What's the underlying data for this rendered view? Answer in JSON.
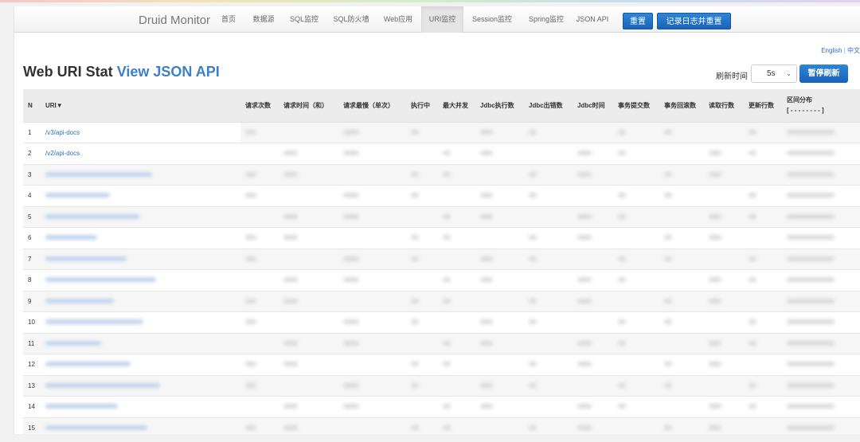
{
  "nav": {
    "brand": "Druid Monitor",
    "items": [
      "首页",
      "数据源",
      "SQL监控",
      "SQL防火墙",
      "Web应用",
      "URI监控",
      "Session监控",
      "Spring监控",
      "JSON API"
    ],
    "active_index": 5,
    "reset_label": "重置",
    "reset_log_label": "记录日志并重置"
  },
  "lang": {
    "english": "English",
    "separator": "|",
    "chinese": "中文"
  },
  "page": {
    "title": "Web URI Stat",
    "title_link": "View JSON API",
    "refresh_label": "刷新时间",
    "refresh_value": "5s",
    "pause_label": "暂停刷新"
  },
  "table": {
    "columns": [
      "N",
      "URI▼",
      "请求次数",
      "请求时间（和）",
      "请求最慢（单次）",
      "执行中",
      "最大并发",
      "Jdbc执行数",
      "Jdbc出错数",
      "Jdbc时间",
      "事务提交数",
      "事务回滚数",
      "读取行数",
      "更新行数"
    ],
    "last_column": {
      "title": "区间分布",
      "subtitle": "[ - - - - - - - - ]"
    },
    "rows": [
      {
        "n": "1",
        "uri": "/v3/api-docs"
      },
      {
        "n": "2",
        "uri": "/v2/api-docs"
      },
      {
        "n": "3",
        "uri": ""
      },
      {
        "n": "4",
        "uri": ""
      },
      {
        "n": "5",
        "uri": ""
      },
      {
        "n": "6",
        "uri": ""
      },
      {
        "n": "7",
        "uri": ""
      },
      {
        "n": "8",
        "uri": ""
      },
      {
        "n": "9",
        "uri": ""
      },
      {
        "n": "10",
        "uri": ""
      },
      {
        "n": "11",
        "uri": ""
      },
      {
        "n": "12",
        "uri": ""
      },
      {
        "n": "13",
        "uri": ""
      },
      {
        "n": "14",
        "uri": ""
      },
      {
        "n": "15",
        "uri": ""
      }
    ]
  }
}
